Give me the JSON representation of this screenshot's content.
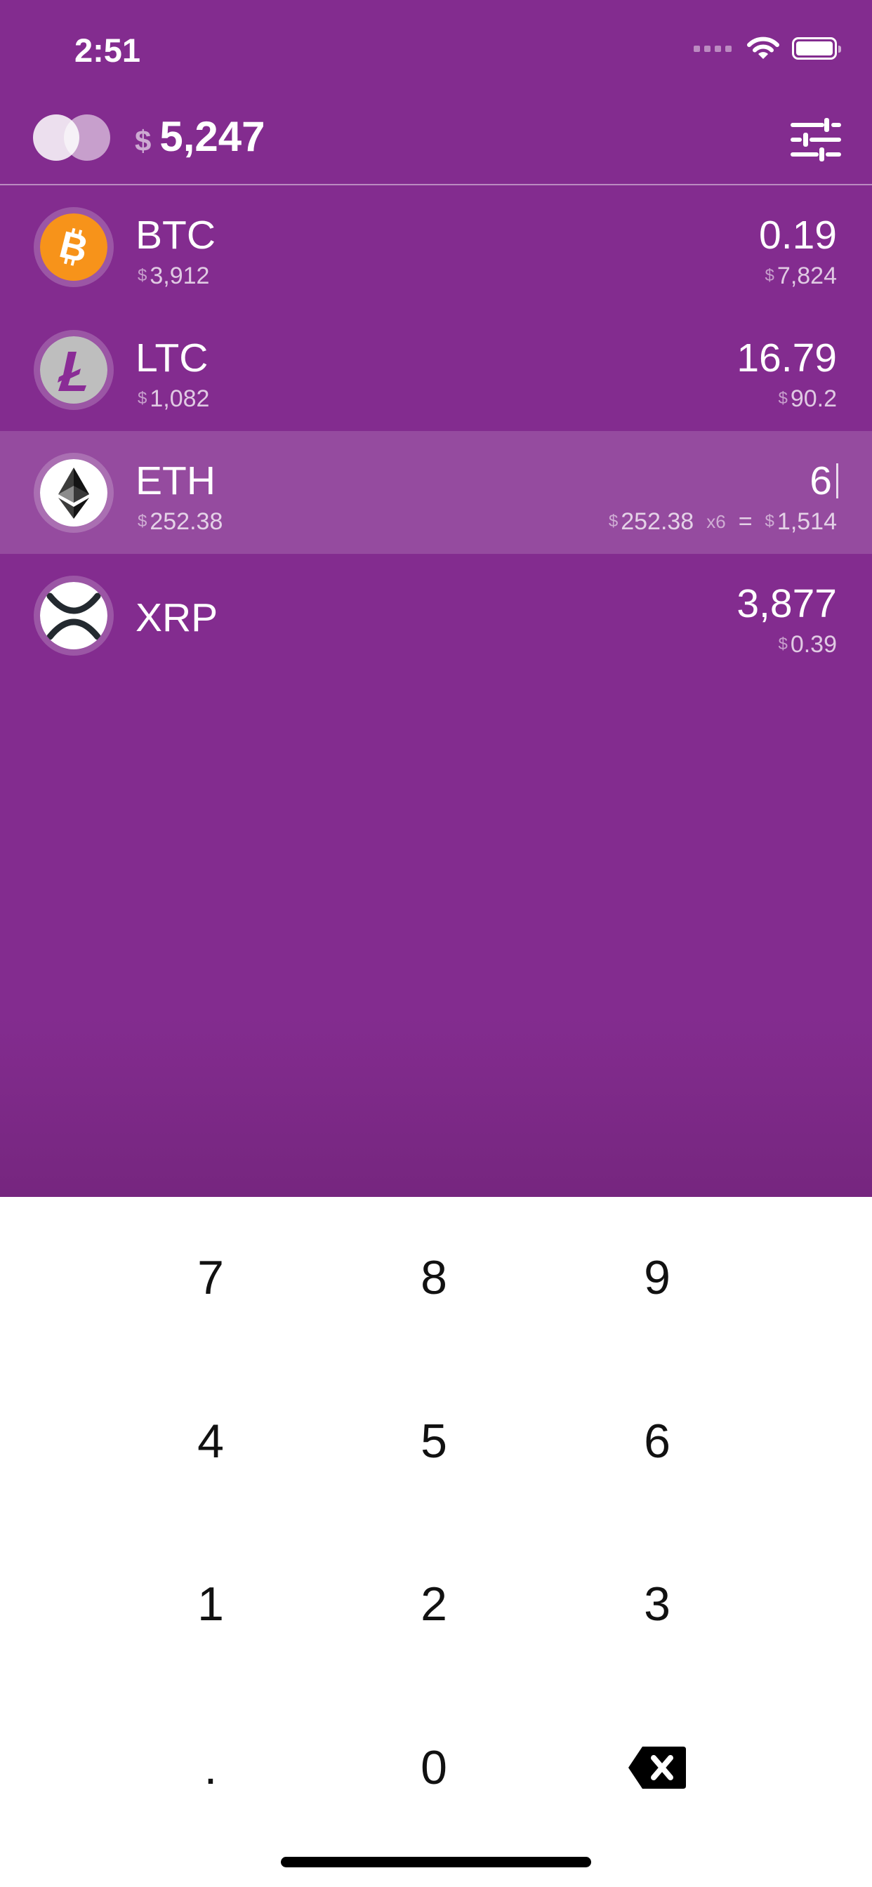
{
  "status_bar": {
    "time": "2:51"
  },
  "header": {
    "currency_symbol": "$",
    "total": "5,247"
  },
  "coins": [
    {
      "symbol": "BTC",
      "price_cur": "$",
      "price": "3,912",
      "quantity": "0.19",
      "value_cur": "$",
      "value": "7,824",
      "icon": "bitcoin-icon"
    },
    {
      "symbol": "LTC",
      "price_cur": "$",
      "price": "1,082",
      "quantity": "16.79",
      "value_cur": "$",
      "value": "90.2",
      "icon": "litecoin-icon"
    },
    {
      "symbol": "ETH",
      "price_cur": "$",
      "price": "252.38",
      "quantity": "6",
      "calc_cur": "$",
      "calc_price": "252.38",
      "multiplier": "x6",
      "equals": "=",
      "value_cur": "$",
      "value": "1,514",
      "icon": "ethereum-icon",
      "selected": true
    },
    {
      "symbol": "XRP",
      "quantity": "3,877",
      "value_cur": "$",
      "value": "0.39",
      "icon": "ripple-icon"
    }
  ],
  "keypad": {
    "keys": [
      "7",
      "8",
      "9",
      "4",
      "5",
      "6",
      "1",
      "2",
      "3",
      ".",
      "0"
    ],
    "backspace_icon": "backspace-icon"
  },
  "colors": {
    "background": "#832c8f",
    "btc": "#f7931a",
    "ltc": "#bebebe",
    "keypad": "#ffffff"
  }
}
